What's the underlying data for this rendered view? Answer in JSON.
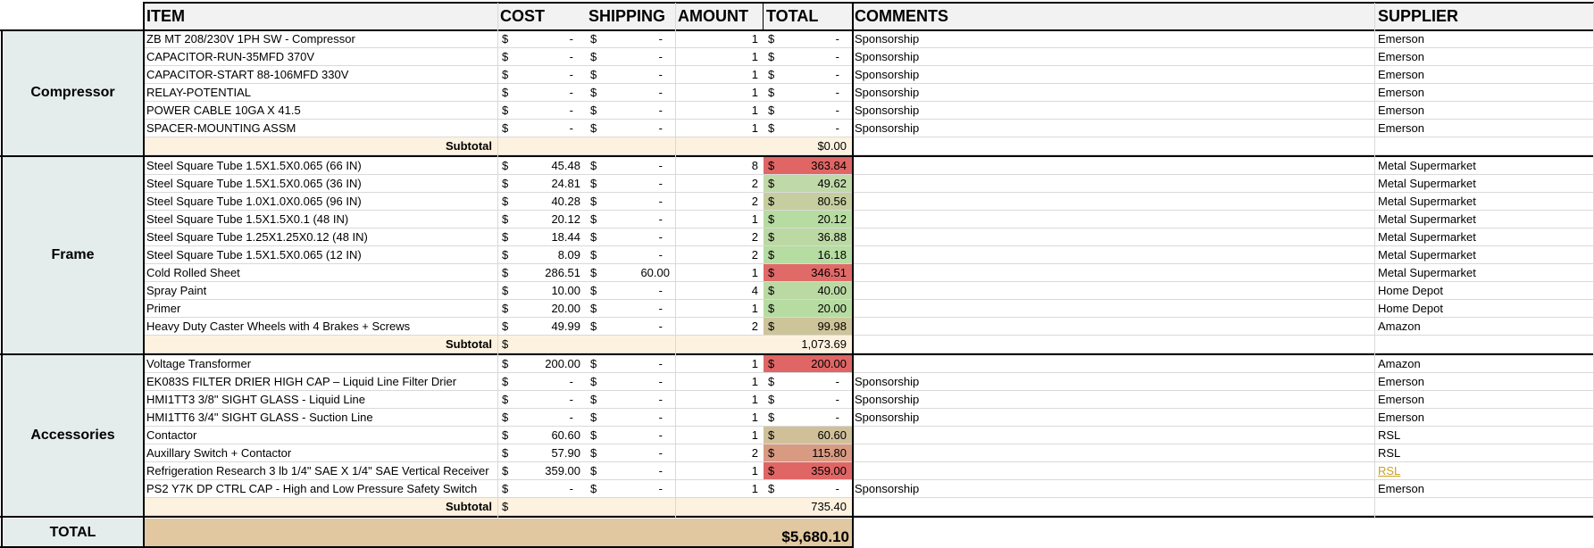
{
  "headers": {
    "item": "ITEM",
    "cost": "COST",
    "shipping": "SHIPPING",
    "amount": "AMOUNT",
    "total": "TOTAL",
    "comments": "COMMENTS",
    "supplier": "SUPPLIER"
  },
  "sections": [
    {
      "name": "Compressor",
      "rows": [
        {
          "item": "ZB MT 208/230V 1PH SW - Compressor",
          "cost": "-",
          "shipping": "-",
          "amount": "1",
          "total": "-",
          "comments": "Sponsorship",
          "supplier": "Emerson"
        },
        {
          "item": "CAPACITOR-RUN-35MFD 370V",
          "cost": "-",
          "shipping": "-",
          "amount": "1",
          "total": "-",
          "comments": "Sponsorship",
          "supplier": "Emerson"
        },
        {
          "item": "CAPACITOR-START 88-106MFD 330V",
          "cost": "-",
          "shipping": "-",
          "amount": "1",
          "total": "-",
          "comments": "Sponsorship",
          "supplier": "Emerson"
        },
        {
          "item": "RELAY-POTENTIAL",
          "cost": "-",
          "shipping": "-",
          "amount": "1",
          "total": "-",
          "comments": "Sponsorship",
          "supplier": "Emerson"
        },
        {
          "item": "POWER CABLE 10GA X 41.5",
          "cost": "-",
          "shipping": "-",
          "amount": "1",
          "total": "-",
          "comments": "Sponsorship",
          "supplier": "Emerson"
        },
        {
          "item": "SPACER-MOUNTING ASSM",
          "cost": "-",
          "shipping": "-",
          "amount": "1",
          "total": "-",
          "comments": "Sponsorship",
          "supplier": "Emerson"
        }
      ],
      "subtotal_label": "Subtotal",
      "subtotal_currency": "",
      "subtotal_value": "$0.00"
    },
    {
      "name": "Frame",
      "rows": [
        {
          "item": "Steel Square Tube 1.5X1.5X0.065 (66 IN)",
          "cost": "45.48",
          "shipping": "-",
          "amount": "8",
          "total": "363.84",
          "comments": "",
          "supplier": "Metal Supermarket",
          "color": "#e06666"
        },
        {
          "item": "Steel Square Tube 1.5X1.5X0.065 (36 IN)",
          "cost": "24.81",
          "shipping": "-",
          "amount": "2",
          "total": "49.62",
          "comments": "",
          "supplier": "Metal Supermarket",
          "color": "#bfd9a8"
        },
        {
          "item": "Steel Square Tube 1.0X1.0X0.065 (96 IN)",
          "cost": "40.28",
          "shipping": "-",
          "amount": "2",
          "total": "80.56",
          "comments": "",
          "supplier": "Metal Supermarket",
          "color": "#c6cd9f"
        },
        {
          "item": "Steel Square Tube 1.5X1.5X0.1 (48 IN)",
          "cost": "20.12",
          "shipping": "-",
          "amount": "1",
          "total": "20.12",
          "comments": "",
          "supplier": "Metal Supermarket",
          "color": "#b7dca2"
        },
        {
          "item": "Steel Square Tube 1.25X1.25X0.12 (48 IN)",
          "cost": "18.44",
          "shipping": "-",
          "amount": "2",
          "total": "36.88",
          "comments": "",
          "supplier": "Metal Supermarket",
          "color": "#bcd9a4"
        },
        {
          "item": "Steel Square Tube 1.5X1.5X0.065 (12 IN)",
          "cost": "8.09",
          "shipping": "-",
          "amount": "2",
          "total": "16.18",
          "comments": "",
          "supplier": "Metal Supermarket",
          "color": "#b5dca1"
        },
        {
          "item": "Cold Rolled Sheet",
          "cost": "286.51",
          "shipping": "60.00",
          "amount": "1",
          "total": "346.51",
          "comments": "",
          "supplier": "Metal Supermarket",
          "color": "#e06a68"
        },
        {
          "item": "Spray Paint",
          "cost": "10.00",
          "shipping": "-",
          "amount": "4",
          "total": "40.00",
          "comments": "",
          "supplier": "Home Depot",
          "color": "#bad9a3"
        },
        {
          "item": "Primer",
          "cost": "20.00",
          "shipping": "-",
          "amount": "1",
          "total": "20.00",
          "comments": "",
          "supplier": "Home Depot",
          "color": "#b7dca2"
        },
        {
          "item": "Heavy Duty Caster Wheels with 4 Brakes + Screws",
          "cost": "49.99",
          "shipping": "-",
          "amount": "2",
          "total": "99.98",
          "comments": "",
          "supplier": "Amazon",
          "color": "#cdc49a"
        }
      ],
      "subtotal_label": "Subtotal",
      "subtotal_currency": "$",
      "subtotal_value": "1,073.69"
    },
    {
      "name": "Accessories",
      "rows": [
        {
          "item": "Voltage Transformer",
          "cost": "200.00",
          "shipping": "-",
          "amount": "1",
          "total": "200.00",
          "comments": "",
          "supplier": "Amazon",
          "color": "#e06666"
        },
        {
          "item": "EK083S FILTER DRIER HIGH CAP – Liquid Line Filter Drier",
          "cost": "-",
          "shipping": "-",
          "amount": "1",
          "total": "-",
          "comments": "Sponsorship",
          "supplier": "Emerson"
        },
        {
          "item": "HMI1TT3 3/8\"  SIGHT GLASS - Liquid Line",
          "cost": "-",
          "shipping": "-",
          "amount": "1",
          "total": "-",
          "comments": "Sponsorship",
          "supplier": "Emerson"
        },
        {
          "item": "HMI1TT6 3/4\"  SIGHT GLASS - Suction Line",
          "cost": "-",
          "shipping": "-",
          "amount": "1",
          "total": "-",
          "comments": "Sponsorship",
          "supplier": "Emerson"
        },
        {
          "item": "Contactor",
          "cost": "60.60",
          "shipping": "-",
          "amount": "1",
          "total": "60.60",
          "comments": "",
          "supplier": "RSL",
          "color": "#d0c09a"
        },
        {
          "item": "Auxillary Switch + Contactor",
          "cost": "57.90",
          "shipping": "-",
          "amount": "2",
          "total": "115.80",
          "comments": "",
          "supplier": "RSL",
          "color": "#d99a82"
        },
        {
          "item": "Refrigeration Research 3 lb 1/4\" SAE X 1/4\" SAE Vertical Receiver",
          "cost": "359.00",
          "shipping": "-",
          "amount": "1",
          "total": "359.00",
          "comments": "",
          "supplier": "RSL",
          "color": "#e06666",
          "supplier_link": true
        },
        {
          "item": "PS2 Y7K DP CTRL CAP - High and Low Pressure Safety Switch",
          "cost": "-",
          "shipping": "-",
          "amount": "1",
          "total": "-",
          "comments": "Sponsorship",
          "supplier": "Emerson"
        }
      ],
      "subtotal_label": "Subtotal",
      "subtotal_currency": "$",
      "subtotal_value": "735.40"
    }
  ],
  "grand_total": {
    "label": "TOTAL",
    "value": "$5,680.10"
  },
  "currency_symbol": "$",
  "colors": {
    "section_label_bg": "#e4ecec",
    "subtotal_bg": "#fdf2df",
    "grand_total_bg": "#e1c8a0",
    "header_bg": "#f2f2f2"
  }
}
